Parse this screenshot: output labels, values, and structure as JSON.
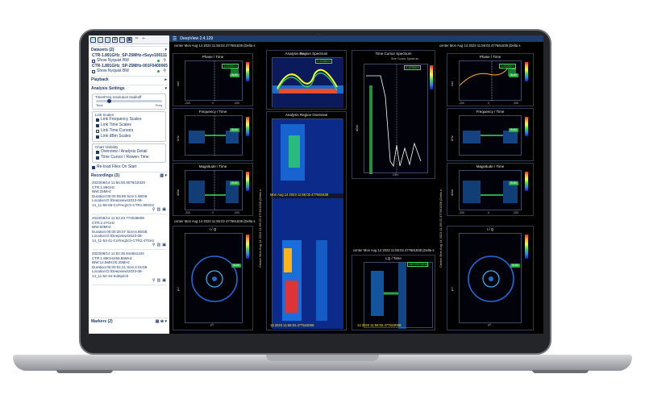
{
  "app": {
    "title": "DeepView 2.4.129"
  },
  "colors": {
    "accent": "#1d3b6b",
    "status_green": "#39e35a",
    "auto_green": "#2aa845"
  },
  "toolbar": {
    "icons": [
      "folder-icon",
      "file-icon",
      "file-icon",
      "copy-icon",
      "folder-open-icon",
      "camera-icon",
      "cut-icon",
      "back-icon"
    ]
  },
  "datasets": {
    "header": "Datasets (2)",
    "items": [
      {
        "name": "CTR-1.891GHz_SP-25MHz-rSeyo100111",
        "show_label": "Show Nyquist BW"
      },
      {
        "name": "CTR-1.891GHz_SP-25MHz-001F0400065",
        "show_label": "Show Nyquist BW"
      }
    ]
  },
  "playback": {
    "header": "Playback"
  },
  "analysis": {
    "header": "Analysis Settings",
    "tradeoff_label": "Time/Freq resolution tradeoff",
    "time_label": "Time",
    "freq_label": "Freq",
    "link_scales": {
      "title": "Link Scales",
      "items": [
        {
          "label": "Link Frequency Scales",
          "checked": true
        },
        {
          "label": "Link Time Scales",
          "checked": true
        },
        {
          "label": "Link Time Cursors",
          "checked": false
        },
        {
          "label": "Link dBm Scales",
          "checked": true
        }
      ]
    },
    "chart_visibility": {
      "title": "Chart Visibility",
      "items": [
        {
          "label": "Overview / Analysis Detail",
          "checked": true
        },
        {
          "label": "Time Cursor / Rowen-Time",
          "checked": true
        }
      ]
    },
    "reload_label": "Re-load Files On Start"
  },
  "recordings": {
    "header": "Recordings (3)",
    "items": [
      {
        "lines": [
          "2023/08/14 11:56:00.9079/18320",
          "CTR:1.89GHz",
          "IBW:25MHz",
          "Duration:00:00:08.99 Size:1.98GB",
          "Location:D:\\Deepview\\2023-08-",
          "14_11-55-58-CoFreq2ch-CTR1.89GHz"
        ]
      },
      {
        "lines": [
          "2023/08/14 11:53:43.774038608",
          "CTR:2.47GHz",
          "IBW:50MHz",
          "Duration:00:00:28.07 Size:6.86GB",
          "Location:D:\\Deepview\\2023-08-",
          "14_11-53-41-CoFreq2ch-CTR2.47GHz"
        ]
      },
      {
        "lines": [
          "2023/08/14 11:52:36.844651344",
          "CTR:1.89GHz/69.89MHz",
          "IBW:12.5MHz/6.25MHz",
          "Duration:00:00:02.21 Size:2.01GB",
          "Location:D:\\Deepview\\2023-08-",
          "14_11-52-34-Indep2ch"
        ]
      }
    ]
  },
  "markers": {
    "header": "Markers (2)"
  },
  "plots": {
    "left_phase": {
      "title": "Phase / Time",
      "ylabel": "rad",
      "value": "3.4336624",
      "auto": "Auto"
    },
    "left_freq": {
      "title": "Frequency / Time",
      "ylabel": "kHz",
      "auto": "Auto"
    },
    "left_mag": {
      "title": "Magnitude / Time",
      "ylabel": "dBm",
      "auto": "Auto"
    },
    "left_iq": {
      "title": "I / Q",
      "xlabel": "μV",
      "ylabel": "μV",
      "auto": "Auto"
    },
    "analysis_spectrum": {
      "title": "Analysis Region Spectrum",
      "ylabel": "dBm",
      "value": "3.4336624",
      "xlabel": "GHz"
    },
    "analysis_overview": {
      "title": "Analysis Region Overview"
    },
    "time_cursor": {
      "title": "Time Cursor Spectrum",
      "legend": "Sine Cursor Spectrum",
      "ylabel": "dBm",
      "value": "3.4336624",
      "xlabel": "GHz"
    },
    "lq_time": {
      "title": "LQ / Time",
      "value": "280.0022MHz"
    },
    "right_phase": {
      "title": "Phase / Time",
      "ylabel": "rad",
      "value": "3.4336624",
      "auto": "Auto"
    },
    "right_freq": {
      "title": "Frequency / Time",
      "ylabel": "kHz",
      "auto": "Auto"
    },
    "right_mag": {
      "title": "Magnitude / Time",
      "ylabel": "dBm",
      "auto": "Auto"
    },
    "right_iq": {
      "title": "I / Q",
      "xlabel": "μV",
      "ylabel": "μV",
      "auto": "Auto"
    }
  },
  "timestamps": {
    "center_top_left": "center Mon Aug 14 2023 11:56:02.477661638 (Delta s",
    "center_top_right": "center Mon Aug 14 2023 11:56:02.477661638 (Delta s",
    "center_mid_left": "center Mon Aug 14 2023 11:56:02.477661638 (Delta s",
    "center_mid_right": "center Mon Aug 14 2023 11:56:02.477661638 (Delta s",
    "overview_cursor": "Mon Aug 14 2023 11:56:02.477661638",
    "overview_bottom": "14 2023 11:56:02.477643008",
    "lq_bottom": "14 2023 11:56:02.477643008",
    "side_left": "Center Mon Aug 14 2023 11:56:02.477661638 (Delta s",
    "side_right": "Center Mon Aug 14 2023 11:56:02.477661638 (Delta s"
  },
  "axis_ticks": {
    "time_x": [
      "-200",
      "0",
      "200"
    ],
    "ghz_x": [
      "1.89",
      "1.892",
      "1.894"
    ],
    "ghz_x_cursor": [
      "1.89",
      "1.892",
      "1.894"
    ],
    "ghz_label": "GHz",
    "db_y": [
      "-80",
      "-90",
      "-100",
      "-110",
      "-120",
      "-130"
    ],
    "spectrum_y": [
      "-80",
      "-90",
      "-100",
      "-110",
      "-120",
      "-130",
      "-140",
      "-150"
    ]
  }
}
